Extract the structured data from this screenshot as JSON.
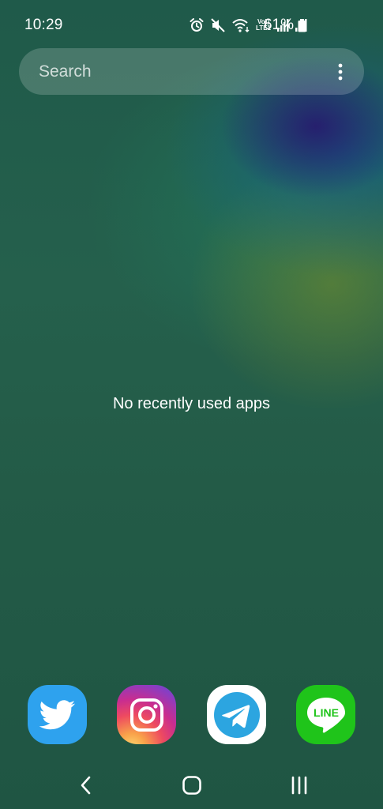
{
  "status_bar": {
    "time": "10:29",
    "volte_top": "Vo))",
    "volte_bottom": "LTE1",
    "battery_percent": "61%",
    "icons": [
      "alarm-icon",
      "mute-icon",
      "wifi-icon",
      "volte-icon",
      "signal-icon",
      "signal-icon",
      "battery-icon"
    ]
  },
  "search": {
    "placeholder": "Search",
    "more_icon": "more-vertical-icon"
  },
  "recents": {
    "empty_message": "No recently used apps"
  },
  "dock": {
    "apps": [
      {
        "name": "Twitter",
        "icon": "twitter-icon",
        "color": "#2ea2ee"
      },
      {
        "name": "Instagram",
        "icon": "instagram-icon",
        "color": "#e1306c"
      },
      {
        "name": "Telegram",
        "icon": "telegram-icon",
        "color": "#2ca5e0"
      },
      {
        "name": "LINE",
        "icon": "line-icon",
        "color": "#1fc41a",
        "label": "LINE"
      }
    ]
  },
  "nav_bar": {
    "buttons": [
      "back-icon",
      "home-icon",
      "recents-icon"
    ]
  }
}
